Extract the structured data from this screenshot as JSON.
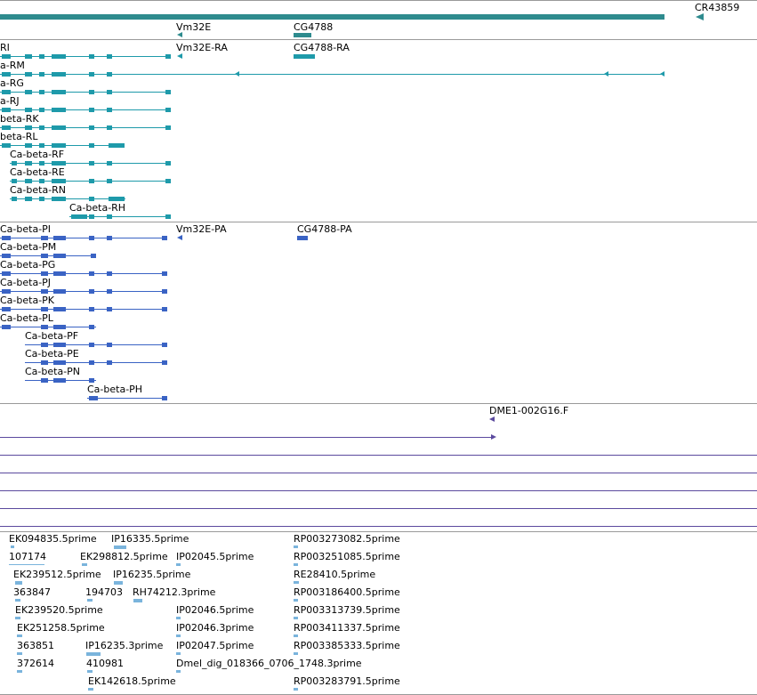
{
  "colors": {
    "gene": "#2e8b8e",
    "mrna": "#1e9aaa",
    "protein": "#3a63c4",
    "clone": "#5b4a9e",
    "est": "#7ab4dc",
    "separator": "#9a9a9a"
  },
  "genes": {
    "cr43859": "CR43859",
    "vm32e": "Vm32E",
    "cg4788": "CG4788"
  },
  "transcripts": {
    "ri": "RI",
    "rm": "a-RM",
    "rg": "a-RG",
    "rj": "a-RJ",
    "rk": "beta-RK",
    "rl": "beta-RL",
    "rf": "Ca-beta-RF",
    "re": "Ca-beta-RE",
    "rn": "Ca-beta-RN",
    "rh": "Ca-beta-RH",
    "vm32e_ra": "Vm32E-RA",
    "cg4788_ra": "CG4788-RA"
  },
  "proteins": {
    "pi": "Ca-beta-PI",
    "pm": "Ca-beta-PM",
    "pg": "Ca-beta-PG",
    "pj": "Ca-beta-PJ",
    "pk": "Ca-beta-PK",
    "pl": "Ca-beta-PL",
    "pf": "Ca-beta-PF",
    "pe": "Ca-beta-PE",
    "pn": "Ca-beta-PN",
    "ph": "Ca-beta-PH",
    "vm32e_pa": "Vm32E-PA",
    "cg4788_pa": "CG4788-PA"
  },
  "clones": {
    "dme1": "DME1-002G16.F"
  },
  "ests": {
    "ek094835": "EK094835.5prime",
    "ip16335": "IP16335.5prime",
    "rp003273082": "RP003273082.5prime",
    "n107174": "107174",
    "ek298812": "EK298812.5prime",
    "ip02045": "IP02045.5prime",
    "rp003251085": "RP003251085.5prime",
    "ek239512": "EK239512.5prime",
    "ip16235": "IP16235.5prime",
    "re28410": "RE28410.5prime",
    "n363847": "363847",
    "n194703": "194703",
    "rh74212": "RH74212.3prime",
    "rp003186400": "RP003186400.5prime",
    "ek239520": "EK239520.5prime",
    "ip02046_5": "IP02046.5prime",
    "rp003313739": "RP003313739.5prime",
    "ek251258": "EK251258.5prime",
    "ip02046_3": "IP02046.3prime",
    "rp003411337": "RP003411337.5prime",
    "n363851": "363851",
    "ip16235_3": "IP16235.3prime",
    "ip02047": "IP02047.5prime",
    "rp003385333": "RP003385333.5prime",
    "n372614": "372614",
    "n410981": "410981",
    "dmel_dig": "Dmel_dig_018366_0706_1748.3prime",
    "ek142618": "EK142618.5prime",
    "rp003283791": "RP003283791.5prime"
  }
}
